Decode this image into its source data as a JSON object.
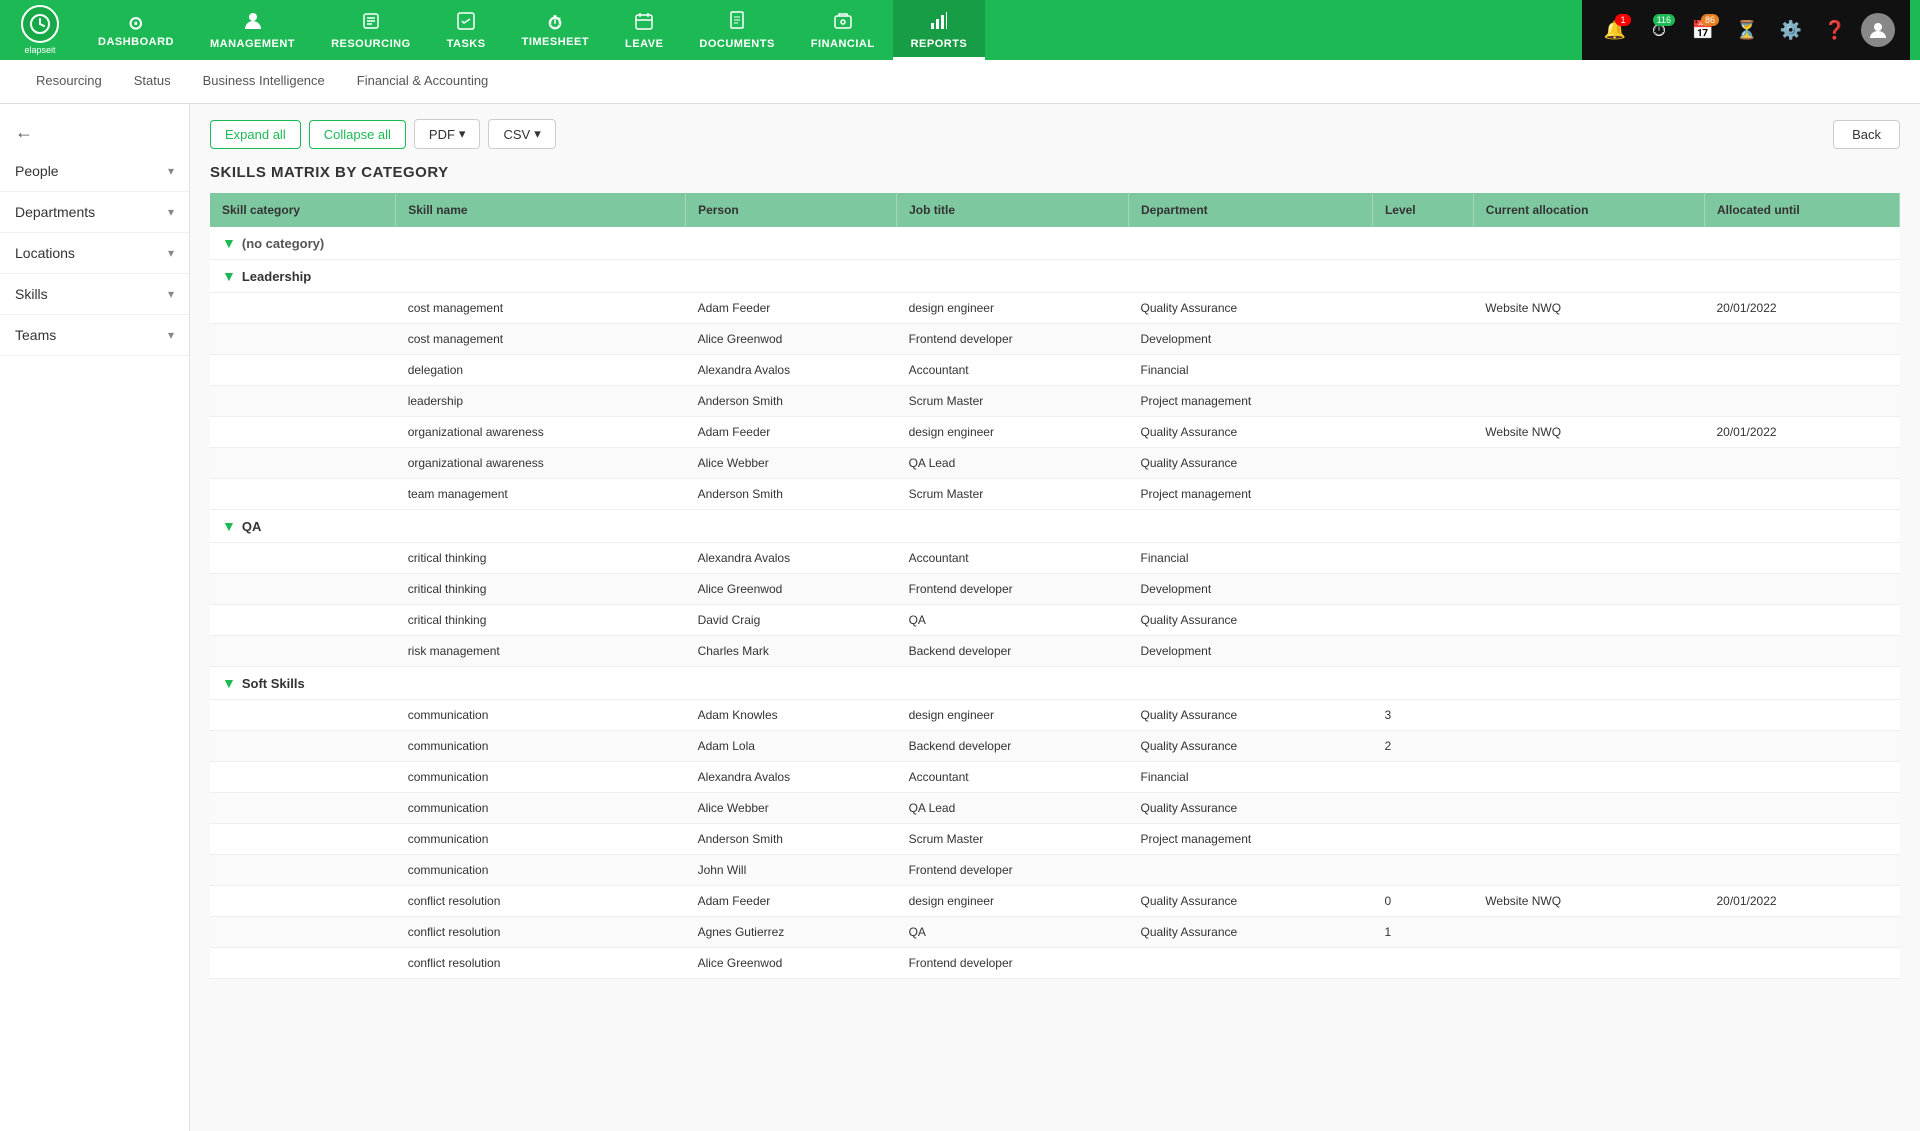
{
  "app": {
    "logo_text": "elapseit"
  },
  "top_nav": {
    "items": [
      {
        "id": "dashboard",
        "label": "DASHBOARD",
        "icon": "⊙"
      },
      {
        "id": "management",
        "label": "MANAGEMENT",
        "icon": "👤"
      },
      {
        "id": "resourcing",
        "label": "RESOURCING",
        "icon": "📋"
      },
      {
        "id": "tasks",
        "label": "TASKS",
        "icon": "☑"
      },
      {
        "id": "timesheet",
        "label": "TIMESHEET",
        "icon": "⏱"
      },
      {
        "id": "leave",
        "label": "LEAVE",
        "icon": "🗓"
      },
      {
        "id": "documents",
        "label": "DOCUMENTS",
        "icon": "📄"
      },
      {
        "id": "financial",
        "label": "FINANCIAL",
        "icon": "💼"
      },
      {
        "id": "reports",
        "label": "REPORTS",
        "icon": "📊",
        "active": true
      }
    ],
    "badges": {
      "notifications": "1",
      "timer": "116",
      "calendar": "86"
    }
  },
  "sub_nav": {
    "items": [
      {
        "id": "resourcing",
        "label": "Resourcing"
      },
      {
        "id": "status",
        "label": "Status"
      },
      {
        "id": "business_intelligence",
        "label": "Business Intelligence"
      },
      {
        "id": "financial_accounting",
        "label": "Financial & Accounting"
      }
    ]
  },
  "sidebar": {
    "back_icon": "←",
    "items": [
      {
        "id": "people",
        "label": "People"
      },
      {
        "id": "departments",
        "label": "Departments"
      },
      {
        "id": "locations",
        "label": "Locations"
      },
      {
        "id": "skills",
        "label": "Skills"
      },
      {
        "id": "teams",
        "label": "Teams"
      }
    ]
  },
  "toolbar": {
    "expand_all": "Expand all",
    "collapse_all": "Collapse all",
    "pdf_label": "PDF",
    "csv_label": "CSV",
    "back_label": "Back"
  },
  "page_title": "SKILLS MATRIX BY CATEGORY",
  "table": {
    "headers": [
      "Skill category",
      "Skill name",
      "Person",
      "Job title",
      "Department",
      "Level",
      "Current allocation",
      "Allocated until"
    ],
    "categories": [
      {
        "name": "(no category)",
        "is_no_category": true,
        "rows": []
      },
      {
        "name": "Leadership",
        "rows": [
          {
            "skill": "cost management",
            "person": "Adam Feeder",
            "job": "design engineer",
            "dept": "Quality Assurance",
            "level": "",
            "allocation": "Website NWQ",
            "until": "20/01/2022"
          },
          {
            "skill": "cost management",
            "person": "Alice Greenwod",
            "job": "Frontend developer",
            "dept": "Development",
            "level": "",
            "allocation": "",
            "until": ""
          },
          {
            "skill": "delegation",
            "person": "Alexandra Avalos",
            "job": "Accountant",
            "dept": "Financial",
            "level": "",
            "allocation": "",
            "until": ""
          },
          {
            "skill": "leadership",
            "person": "Anderson Smith",
            "job": "Scrum Master",
            "dept": "Project management",
            "level": "",
            "allocation": "",
            "until": ""
          },
          {
            "skill": "organizational awareness",
            "person": "Adam Feeder",
            "job": "design engineer",
            "dept": "Quality Assurance",
            "level": "",
            "allocation": "Website NWQ",
            "until": "20/01/2022"
          },
          {
            "skill": "organizational awareness",
            "person": "Alice Webber",
            "job": "QA Lead",
            "dept": "Quality Assurance",
            "level": "",
            "allocation": "",
            "until": ""
          },
          {
            "skill": "team management",
            "person": "Anderson Smith",
            "job": "Scrum Master",
            "dept": "Project management",
            "level": "",
            "allocation": "",
            "until": ""
          }
        ]
      },
      {
        "name": "QA",
        "rows": [
          {
            "skill": "critical thinking",
            "person": "Alexandra Avalos",
            "job": "Accountant",
            "dept": "Financial",
            "level": "",
            "allocation": "",
            "until": ""
          },
          {
            "skill": "critical thinking",
            "person": "Alice Greenwod",
            "job": "Frontend developer",
            "dept": "Development",
            "level": "",
            "allocation": "",
            "until": ""
          },
          {
            "skill": "critical thinking",
            "person": "David Craig",
            "job": "QA",
            "dept": "Quality Assurance",
            "level": "",
            "allocation": "",
            "until": ""
          },
          {
            "skill": "risk management",
            "person": "Charles Mark",
            "job": "Backend developer",
            "dept": "Development",
            "level": "",
            "allocation": "",
            "until": ""
          }
        ]
      },
      {
        "name": "Soft Skills",
        "rows": [
          {
            "skill": "communication",
            "person": "Adam Knowles",
            "job": "design engineer",
            "dept": "Quality Assurance",
            "level": "3",
            "allocation": "",
            "until": ""
          },
          {
            "skill": "communication",
            "person": "Adam Lola",
            "job": "Backend developer",
            "dept": "Quality Assurance",
            "level": "2",
            "allocation": "",
            "until": ""
          },
          {
            "skill": "communication",
            "person": "Alexandra Avalos",
            "job": "Accountant",
            "dept": "Financial",
            "level": "",
            "allocation": "",
            "until": ""
          },
          {
            "skill": "communication",
            "person": "Alice Webber",
            "job": "QA Lead",
            "dept": "Quality Assurance",
            "level": "",
            "allocation": "",
            "until": ""
          },
          {
            "skill": "communication",
            "person": "Anderson Smith",
            "job": "Scrum Master",
            "dept": "Project management",
            "level": "",
            "allocation": "",
            "until": ""
          },
          {
            "skill": "communication",
            "person": "John Will",
            "job": "Frontend developer",
            "dept": "",
            "level": "",
            "allocation": "",
            "until": ""
          },
          {
            "skill": "conflict resolution",
            "person": "Adam Feeder",
            "job": "design engineer",
            "dept": "Quality Assurance",
            "level": "0",
            "allocation": "Website NWQ",
            "until": "20/01/2022"
          },
          {
            "skill": "conflict resolution",
            "person": "Agnes Gutierrez",
            "job": "QA",
            "dept": "Quality Assurance",
            "level": "1",
            "allocation": "",
            "until": ""
          },
          {
            "skill": "conflict resolution",
            "person": "Alice Greenwod",
            "job": "Frontend developer",
            "dept": "",
            "level": "",
            "allocation": "",
            "until": ""
          }
        ]
      }
    ]
  }
}
